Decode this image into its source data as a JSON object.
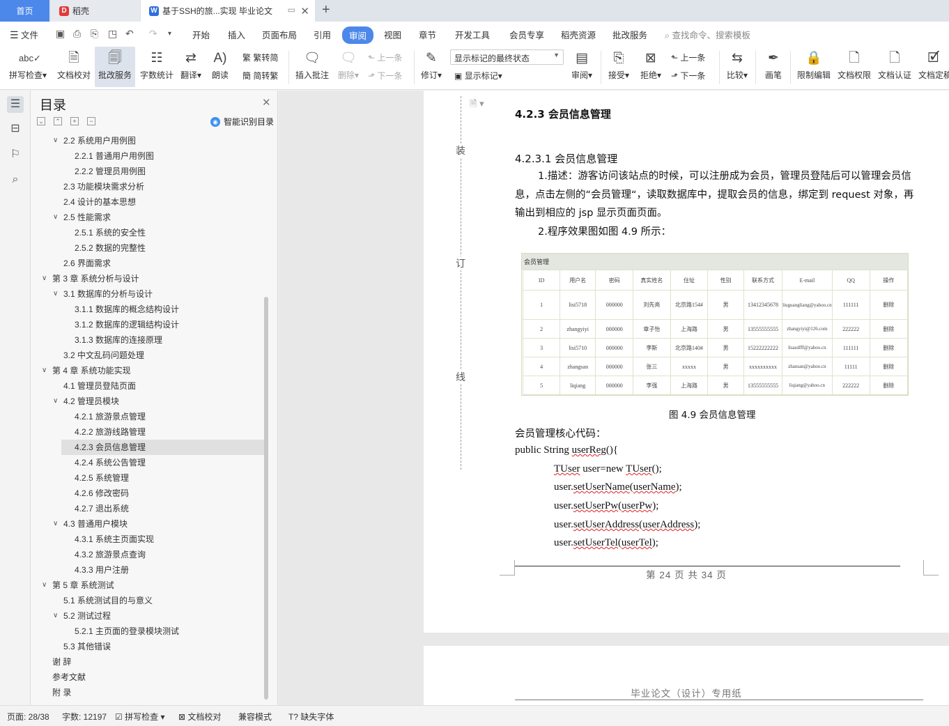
{
  "tabs": {
    "home": "首页",
    "daoke": "稻壳",
    "doc": "基于SSH的旅...实现 毕业论文"
  },
  "menu": {
    "file": "文件",
    "items": [
      "开始",
      "插入",
      "页面布局",
      "引用",
      "审阅",
      "视图",
      "章节",
      "开发工具",
      "会员专享",
      "稻壳资源",
      "批改服务"
    ],
    "search": "查找命令、搜索模板"
  },
  "ribbon": {
    "spell": "拼写检查",
    "proofread": "文档校对",
    "correction": "批改服务",
    "wordcount": "字数统计",
    "translate": "翻译",
    "read": "朗读",
    "to_trad": "繁转简",
    "to_simp": "简转繁",
    "insert_comment": "插入批注",
    "delete": "删除",
    "prev": "上一条",
    "next": "下一条",
    "track": "修订",
    "markup_state": "显示标记的最终状态",
    "show_markup": "显示标记",
    "review": "审阅",
    "accept": "接受",
    "reject": "拒绝",
    "prev2": "上一条",
    "next2": "下一条",
    "compare": "比较",
    "pen": "画笔",
    "restrict": "限制编辑",
    "doc_rights": "文档权限",
    "doc_cert": "文档认证",
    "doc_final": "文档定稿"
  },
  "toc": {
    "title": "目录",
    "smart": "智能识别目录",
    "items": [
      {
        "text": "2.2  系统用户用例图",
        "level": 2,
        "arrow": true
      },
      {
        "text": "2.2.1  普通用户用例图",
        "level": 3
      },
      {
        "text": "2.2.2  管理员用例图",
        "level": 3
      },
      {
        "text": "2.3  功能模块需求分析",
        "level": 2
      },
      {
        "text": "2.4  设计的基本思想",
        "level": 2
      },
      {
        "text": "2.5  性能需求",
        "level": 2,
        "arrow": true
      },
      {
        "text": "2.5.1  系统的安全性",
        "level": 3
      },
      {
        "text": "2.5.2  数据的完整性",
        "level": 3
      },
      {
        "text": "2.6  界面需求",
        "level": 2
      },
      {
        "text": "第 3 章    系统分析与设计",
        "level": 1,
        "arrow": true
      },
      {
        "text": "3.1  数据库的分析与设计",
        "level": 2,
        "arrow": true
      },
      {
        "text": "3.1.1  数据库的概念结构设计",
        "level": 3
      },
      {
        "text": "3.1.2  数据库的逻辑结构设计",
        "level": 3
      },
      {
        "text": "3.1.3  数据库的连接原理",
        "level": 3
      },
      {
        "text": "3.2  中文乱码问题处理",
        "level": 2
      },
      {
        "text": "第 4 章    系统功能实现",
        "level": 1,
        "arrow": true
      },
      {
        "text": "4.1  管理员登陆页面",
        "level": 2
      },
      {
        "text": "4.2  管理员模块",
        "level": 2,
        "arrow": true
      },
      {
        "text": "4.2.1  旅游景点管理",
        "level": 3
      },
      {
        "text": "4.2.2  旅游线路管理",
        "level": 3
      },
      {
        "text": "4.2.3  会员信息管理",
        "level": 3,
        "selected": true
      },
      {
        "text": "4.2.4  系统公告管理",
        "level": 3
      },
      {
        "text": "4.2.5  系统管理",
        "level": 3
      },
      {
        "text": "4.2.6  修改密码",
        "level": 3
      },
      {
        "text": "4.2.7  退出系统",
        "level": 3
      },
      {
        "text": "4.3  普通用户模块",
        "level": 2,
        "arrow": true
      },
      {
        "text": "4.3.1  系统主页面实现",
        "level": 3
      },
      {
        "text": "4.3.2  旅游景点查询",
        "level": 3
      },
      {
        "text": "4.3.3  用户注册",
        "level": 3
      },
      {
        "text": "第 5 章  系统测试",
        "level": 1,
        "arrow": true
      },
      {
        "text": "5.1  系统测试目的与意义",
        "level": 2
      },
      {
        "text": "5.2  测试过程",
        "level": 2,
        "arrow": true
      },
      {
        "text": "5.2.1  主页面的登录模块测试",
        "level": 3
      },
      {
        "text": "5.3  其他错误",
        "level": 2
      },
      {
        "text": "谢    辞",
        "level": 1
      },
      {
        "text": "参考文献",
        "level": 1
      },
      {
        "text": "附    录",
        "level": 1
      }
    ]
  },
  "doc": {
    "margin_chars": [
      "装",
      "订",
      "线"
    ],
    "h1": "4.2.3  会员信息管理",
    "h2": "4.2.3.1  会员信息管理",
    "para1": "1.描述：游客访问该站点的时候，可以注册成为会员，管理员登陆后可以管理会员信息，点击左侧的“会员管理“，读取数据库中，提取会员的信息，绑定到 request 对象，再输出到相应的 jsp 显示页面页面。",
    "para2": "2.程序效果图如图 4.9 所示：",
    "figure": {
      "title": "会员管理",
      "headers": [
        "ID",
        "用户名",
        "密码",
        "真实姓名",
        "住址",
        "性别",
        "联系方式",
        "E-mail",
        "QQ",
        "操作"
      ],
      "rows": [
        [
          "1",
          "lisi5718",
          "000000",
          "刘先亮",
          "北京路154#",
          "男",
          "13412345678",
          "liuguangliang@yahoo.cn",
          "111111",
          "删除"
        ],
        [
          "2",
          "zhangyiyi",
          "000000",
          "章子怡",
          "上海路",
          "男",
          "13555555555",
          "zhangyiyi@126.com",
          "222222",
          "删除"
        ],
        [
          "3",
          "lisi5710",
          "000000",
          "李斯",
          "北京路140#",
          "男",
          "15222222222",
          "lisasdfff@yahoo.cn",
          "111111",
          "删除"
        ],
        [
          "4",
          "zhangsan",
          "000000",
          "张三",
          "xxxxx",
          "男",
          "xxxxxxxxxx",
          "zhansan@yahoo.cn",
          "11111",
          "删除"
        ],
        [
          "5",
          "liqiang",
          "000000",
          "李强",
          "上海路",
          "男",
          "13555555555",
          "liqiang@yahoo.cn",
          "222222",
          "删除"
        ]
      ]
    },
    "caption": "图 4.9    会员信息管理",
    "code_title": "会员管理核心代码：",
    "code": [
      "public String userReg(){",
      "TUser user=new TUser();",
      "user.setUserName(userName);",
      "user.setUserPw(userPw);",
      "user.setUserAddress(userAddress);",
      "user.setUserTel(userTel);"
    ],
    "footer": "第 24 页 共 34 页",
    "page2_header": "毕业论文（设计）专用纸"
  },
  "status": {
    "page": "页面: 28/38",
    "words": "字数: 12197",
    "spell": "拼写检查",
    "proof": "文档校对",
    "compat": "兼容模式",
    "missing_font": "缺失字体"
  },
  "colors": {
    "accent": "#4c88e9",
    "squiggle": "#e02020"
  }
}
